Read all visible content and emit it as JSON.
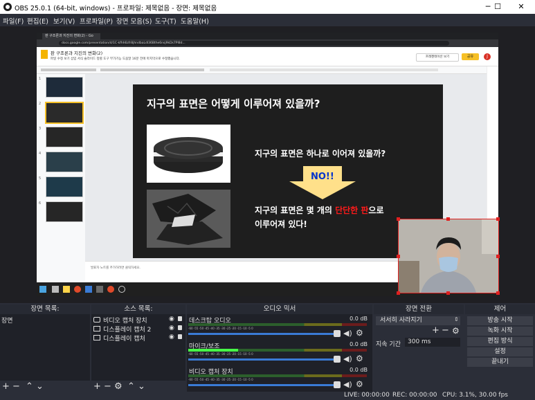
{
  "window": {
    "title": "OBS 25.0.1 (64-bit, windows) - 프로파일: 제목없음 - 장면: 제목없음",
    "minimize": "─",
    "maximize": "☐",
    "close": "✕"
  },
  "menu": [
    "파일(F)",
    "편집(E)",
    "보기(V)",
    "프로파일(P)",
    "장면 모음(S)",
    "도구(T)",
    "도움말(H)"
  ],
  "browser": {
    "tab_title": "판 구조론과 지진의 변화(2) - Go",
    "url": "docs.google.com/presentation/d/1C-kfhh6zfr8jhndbaLdl36Bthe6nsj9kDs7Pl8d... ",
    "docs_title": "판 구조론과 지진의 변화(2)",
    "docs_menu": "파일  수정  보기  삽입  서식  슬라이드  정렬  도구  부가기능  도움말   16분 전에 마지막으로 수정했습니다.",
    "present_label": "프레젠테이션 보기",
    "share_label": "공유",
    "avatar_letter": "J",
    "notes_placeholder": "발표자 노트를 추가하려면 클릭하세요."
  },
  "slide": {
    "title": "지구의 표면은 어떻게 이루어져 있을까?",
    "question": "지구의 표면은 하나로 이어져 있을까?",
    "arrow_text": "NO!!",
    "answer_prefix": "지구의 표면은 몇 개의 ",
    "answer_highlight": "단단한 판",
    "answer_suffix": "으로",
    "answer_line2": "이루어져 있다!"
  },
  "thumbnail_numbers": [
    "1",
    "2",
    "3",
    "4",
    "5",
    "6"
  ],
  "docks": {
    "scenes": {
      "title": "장면 목록:",
      "items": [
        "장면"
      ]
    },
    "sources": {
      "title": "소스 목록:",
      "items": [
        {
          "label": "비디오 캡처 장치",
          "icon": "camera-icon"
        },
        {
          "label": "디스플레이 캡처 2",
          "icon": "monitor-icon"
        },
        {
          "label": "디스플레이 캡처",
          "icon": "monitor-icon"
        }
      ]
    },
    "mixer": {
      "title": "오디오 믹서",
      "channels": [
        {
          "name": "데스크탑 오디오",
          "db": "0.0 dB"
        },
        {
          "name": "마이크/보조",
          "db": "0.0 dB"
        },
        {
          "name": "비디오 캡처 장치",
          "db": "0.0 dB"
        }
      ],
      "ticks": "-60  -55  -50  -45  -40  -35  -30  -25  -20  -15  -10  -5  0"
    },
    "transitions": {
      "title": "장면 전환",
      "selected": "서서히 사라지기",
      "duration_label": "지속 기간",
      "duration_value": "300 ms"
    },
    "controls": {
      "title": "제어",
      "buttons": [
        "방송 시작",
        "녹화 시작",
        "편집 방식",
        "설정",
        "끝내기"
      ]
    }
  },
  "status": {
    "live": "LIVE: 00:00:00",
    "rec": "REC: 00:00:00",
    "cpu": "CPU: 3.1%, 30.00 fps"
  },
  "colors": {
    "accent": "#3a7bd5",
    "selection": "#e02020",
    "highlight_red": "#ff1a1a",
    "no_text": "#0033cc"
  }
}
